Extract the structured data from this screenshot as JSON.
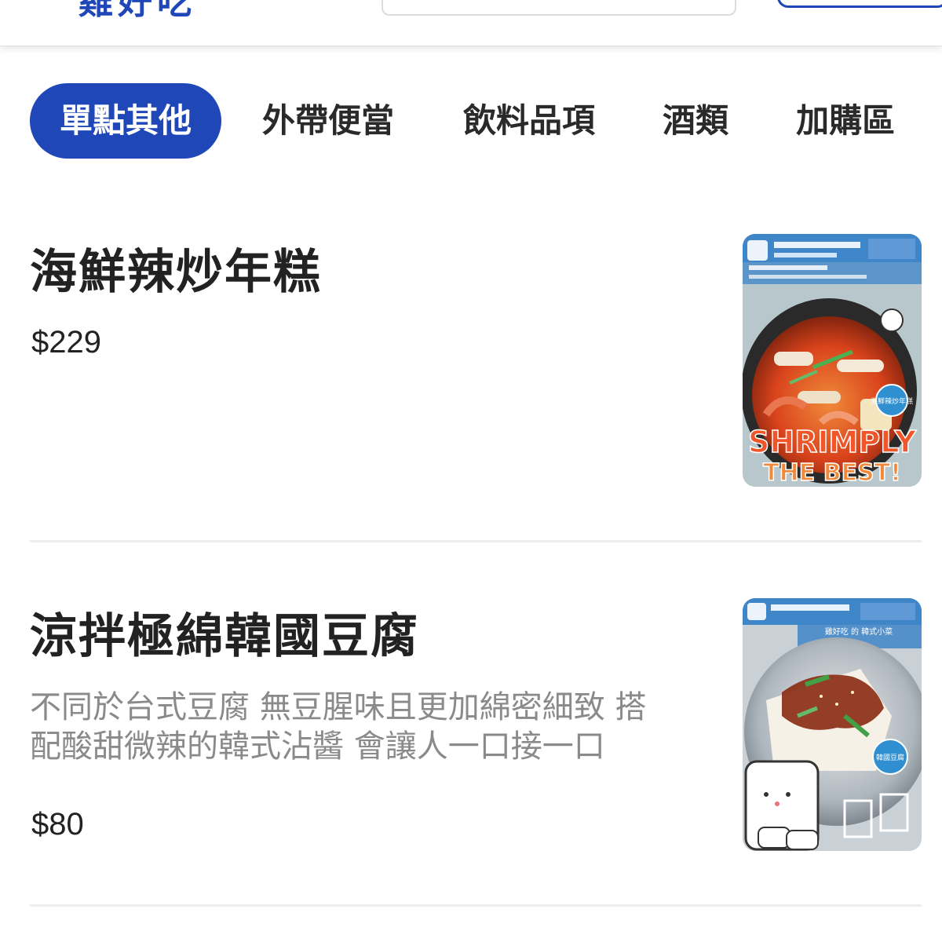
{
  "header": {
    "brand_partial": "雞好吃"
  },
  "tabs": [
    {
      "label": "單點其他",
      "active": true
    },
    {
      "label": "外帶便當",
      "active": false
    },
    {
      "label": "飲料品項",
      "active": false
    },
    {
      "label": "酒類",
      "active": false
    },
    {
      "label": "加購區",
      "active": false
    }
  ],
  "items": [
    {
      "name": "海鮮辣炒年糕",
      "description": "",
      "price": "$229",
      "photo": {
        "overlay_line1": "SHRIMPLY",
        "overlay_line2": "THE BEST!",
        "badge": "海鮮辣炒年糕"
      }
    },
    {
      "name": "涼拌極綿韓國豆腐",
      "description": "不同於台式豆腐 無豆腥味且更加綿密細致 搭配酸甜微辣的韓式沾醬 會讓人一口接一口",
      "price": "$80",
      "photo": {
        "banner": "雞好吃 的 韓式小菜",
        "badge": "韓國豆腐"
      }
    }
  ],
  "colors": {
    "accent": "#1f47b8",
    "divider": "#ededf2",
    "muted_text": "#8a8a8a"
  }
}
